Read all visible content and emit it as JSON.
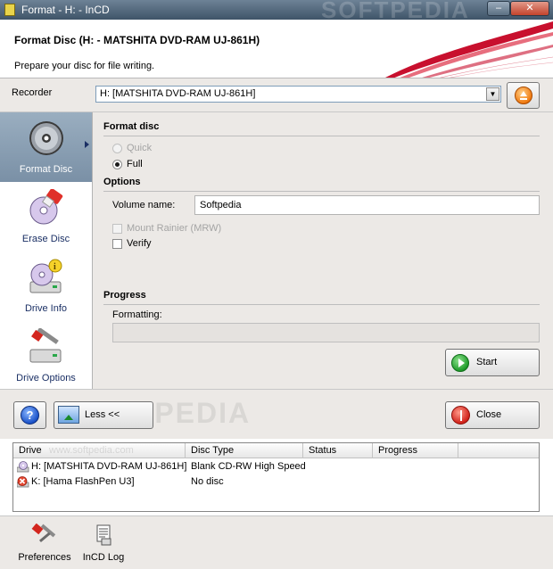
{
  "window": {
    "title": "Format - H: - InCD",
    "watermark": "SOFTPEDIA",
    "controls": {
      "minimize": "–",
      "close": "✕"
    }
  },
  "header": {
    "title": "Format Disc (H: - MATSHITA DVD-RAM UJ-861H)",
    "subtitle": "Prepare your disc for file writing."
  },
  "recorder": {
    "label": "Recorder",
    "selected": "H: [MATSHITA DVD-RAM UJ-861H]",
    "arrow": "▼"
  },
  "sidebar": {
    "items": [
      {
        "label": "Format Disc",
        "active": true,
        "icon": "disc-icon"
      },
      {
        "label": "Erase Disc",
        "active": false,
        "icon": "eraser-disc-icon"
      },
      {
        "label": "Drive Info",
        "active": false,
        "icon": "drive-info-icon"
      },
      {
        "label": "Drive Options",
        "active": false,
        "icon": "drive-options-icon"
      }
    ]
  },
  "format_disc": {
    "title": "Format disc",
    "options": [
      {
        "label": "Quick",
        "checked": false,
        "disabled": true
      },
      {
        "label": "Full",
        "checked": true,
        "disabled": false
      }
    ]
  },
  "options": {
    "title": "Options",
    "volume_label": "Volume name:",
    "volume_value": "Softpedia",
    "mount_rainier_label": "Mount Rainier (MRW)",
    "verify_label": "Verify"
  },
  "progress": {
    "title": "Progress",
    "formatting_label": "Formatting:",
    "percent": 0
  },
  "buttons": {
    "start": "Start",
    "help": "?",
    "less": "Less <<",
    "close": "Close"
  },
  "drive_list": {
    "watermark": "www.softpedia.com",
    "columns": [
      "Drive",
      "Disc Type",
      "Status",
      "Progress"
    ],
    "rows": [
      {
        "drive": "H: [MATSHITA DVD-RAM UJ-861H]",
        "disc_type": "Blank CD-RW High Speed",
        "status": "",
        "progress": "",
        "icon": "cd-drive-icon"
      },
      {
        "drive": "K: [Hama FlashPen U3]",
        "disc_type": "No disc",
        "status": "",
        "progress": "",
        "icon": "error-x-icon"
      }
    ]
  },
  "footer": {
    "preferences": "Preferences",
    "log": "InCD Log"
  },
  "colors": {
    "titlebar": "#4f6579",
    "accent_red": "#c8102e",
    "active_sidebar": "#8aa0b6",
    "panel_bg": "#ece9e6"
  }
}
